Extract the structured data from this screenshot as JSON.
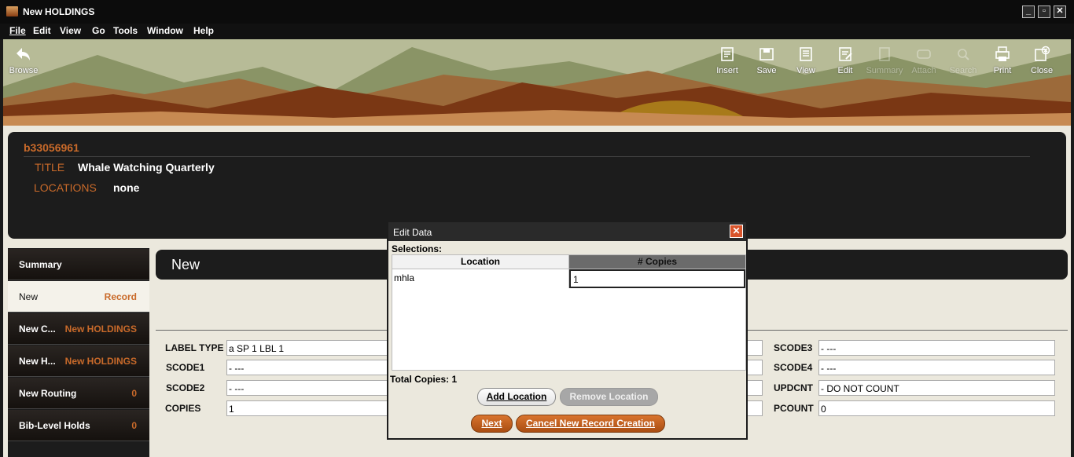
{
  "window": {
    "title": "New HOLDINGS"
  },
  "menu": {
    "items": [
      "File",
      "Edit",
      "View",
      "Go",
      "Tools",
      "Window",
      "Help"
    ]
  },
  "toolbar": {
    "browse": "Browse",
    "buttons": [
      "Insert",
      "Save",
      "View",
      "Edit",
      "Summary",
      "Attach",
      "Search",
      "Print",
      "Close"
    ],
    "disabled": [
      "Summary",
      "Attach",
      "Search"
    ]
  },
  "record": {
    "id": "b33056961",
    "title_label": "TITLE",
    "title_value": "Whale Watching Quarterly",
    "locations_label": "LOCATIONS",
    "locations_value": "none"
  },
  "sidebar": {
    "items": [
      {
        "label": "Summary",
        "right": ""
      },
      {
        "label": "New",
        "right": "Record"
      },
      {
        "label": "New C...",
        "right": "New HOLDINGS"
      },
      {
        "label": "New H...",
        "right": "New HOLDINGS"
      },
      {
        "label": "New Routing",
        "right": "0"
      },
      {
        "label": "Bib-Level Holds",
        "right": "0"
      }
    ]
  },
  "main": {
    "heading": "New"
  },
  "fields": {
    "label_type": {
      "label": "LABEL TYPE",
      "value": "a  SP 1 LBL 1"
    },
    "scode1": {
      "label": "SCODE1",
      "value": "-  ---"
    },
    "scode2": {
      "label": "SCODE2",
      "value": "-  ---"
    },
    "copies": {
      "label": "COPIES",
      "value": "1"
    },
    "scode3": {
      "label": "SCODE3",
      "value": "-  ---"
    },
    "scode4": {
      "label": "SCODE4",
      "value": "-  ---"
    },
    "updcnt": {
      "label": "UPDCNT",
      "value": "-  DO NOT COUNT"
    },
    "pcount": {
      "label": "PCOUNT",
      "value": "0"
    }
  },
  "dialog": {
    "title": "Edit Data",
    "close": "✕",
    "selections_label": "Selections:",
    "columns": [
      "Location",
      "# Copies"
    ],
    "rows": [
      {
        "location": "mhla",
        "copies": "1"
      }
    ],
    "total_label": "Total Copies: 1",
    "add_location": "Add Location",
    "remove_location": "Remove Location",
    "next": "Next",
    "cancel": "Cancel New Record Creation"
  },
  "colors": {
    "accent": "#c96a2a",
    "panel": "#1c1c1c",
    "background": "#ebe8dd"
  }
}
